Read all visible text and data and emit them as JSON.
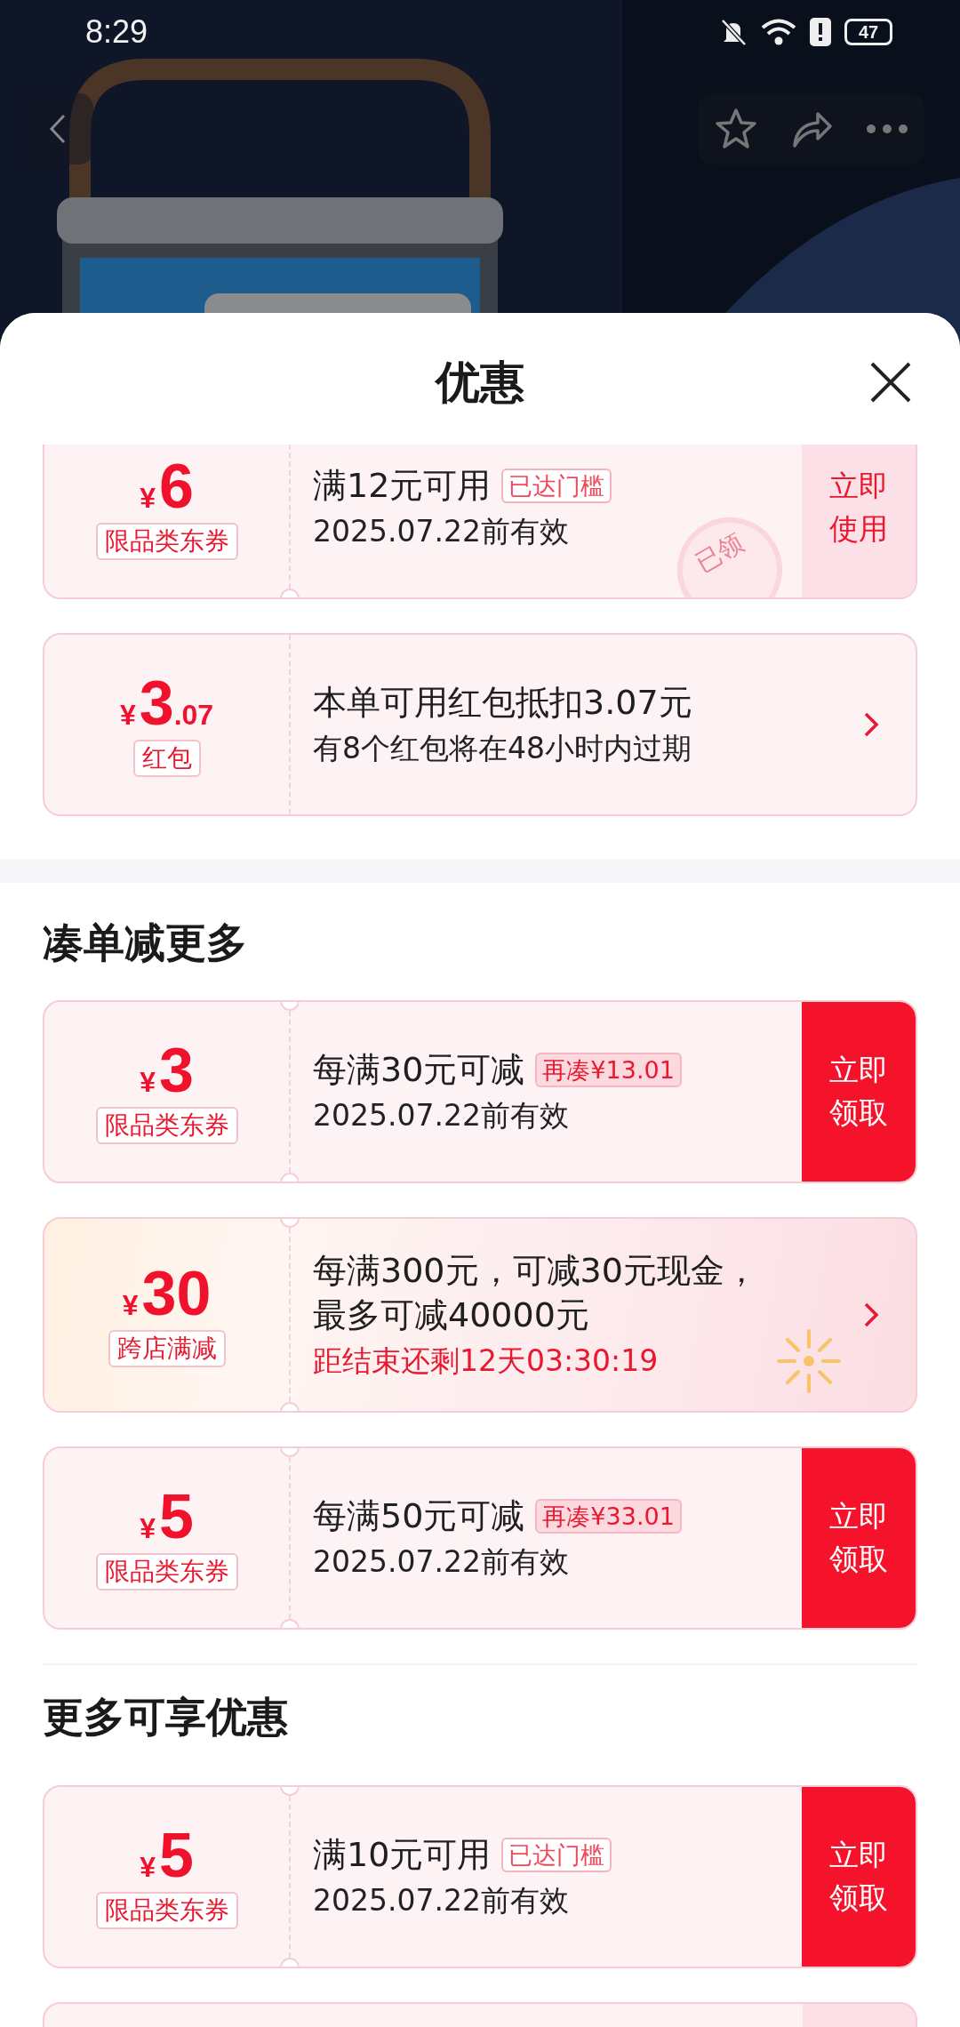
{
  "status_bar": {
    "time": "8:29",
    "battery": "47"
  },
  "sheet": {
    "title": "优惠"
  },
  "top_coupons": [
    {
      "kind": "coupon",
      "currency": "¥",
      "amount": "6",
      "tag": "限品类东券",
      "title": "满12元可用",
      "badge": {
        "text": "已达门槛",
        "kind": "reached"
      },
      "subtitle": "2025.07.22前有效",
      "button": {
        "label": "立即使用",
        "filled": false
      },
      "stamp": "已领"
    },
    {
      "kind": "redpacket",
      "currency": "¥",
      "amount": "3",
      "amount_decimal": ".07",
      "tag": "红包",
      "title": "本单可用红包抵扣3.07元",
      "subtitle": "有8个红包将在48小时内过期"
    }
  ],
  "sections": [
    {
      "heading": "凑单减更多",
      "coupons": [
        {
          "kind": "coupon",
          "currency": "¥",
          "amount": "3",
          "tag": "限品类东券",
          "title": "每满30元可减",
          "badge": {
            "text": "再凑¥13.01",
            "kind": "gap"
          },
          "subtitle": "2025.07.22前有效",
          "button": {
            "label": "立即领取",
            "filled": true
          }
        },
        {
          "kind": "promo",
          "currency": "¥",
          "amount": "30",
          "tag": "跨店满减",
          "title": "每满300元，可减30元现金，最多可减40000元",
          "countdown": "距结束还剩12天03:30:19"
        },
        {
          "kind": "coupon",
          "currency": "¥",
          "amount": "5",
          "tag": "限品类东券",
          "title": "每满50元可减",
          "badge": {
            "text": "再凑¥33.01",
            "kind": "gap"
          },
          "subtitle": "2025.07.22前有效",
          "button": {
            "label": "立即领取",
            "filled": true
          }
        }
      ]
    },
    {
      "heading": "更多可享优惠",
      "coupons": [
        {
          "kind": "coupon",
          "currency": "¥",
          "amount": "5",
          "tag": "限品类东券",
          "title": "满10元可用",
          "badge": {
            "text": "已达门槛",
            "kind": "reached"
          },
          "subtitle": "2025.07.22前有效",
          "button": {
            "label": "立即领取",
            "filled": true
          }
        }
      ]
    }
  ]
}
